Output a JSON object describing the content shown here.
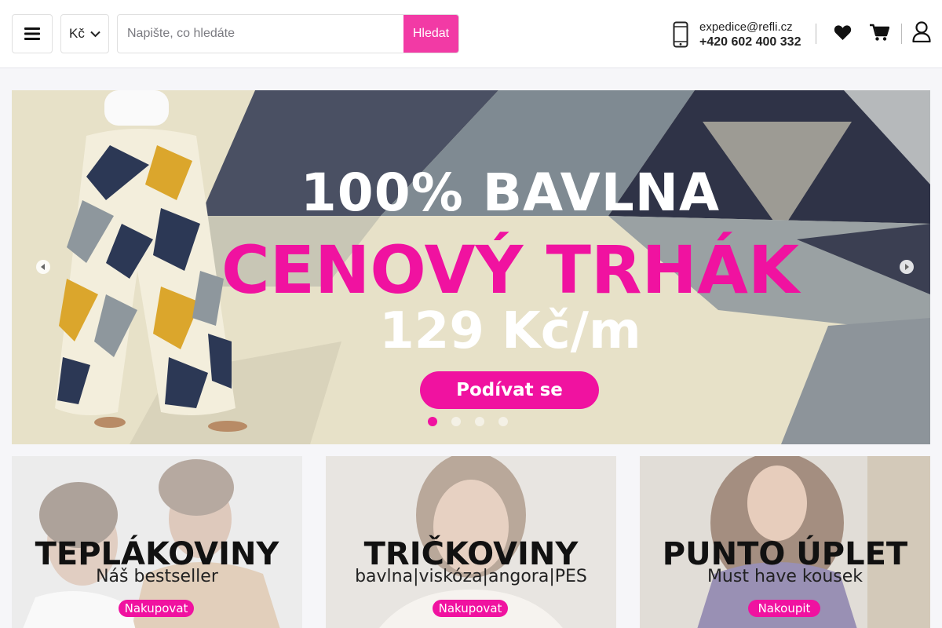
{
  "header": {
    "currency": "Kč",
    "search_placeholder": "Napište, co hledáte",
    "search_button": "Hledat",
    "email": "expedice@refli.cz",
    "phone": "+420 602 400 332"
  },
  "hero": {
    "line1": "100% BAVLNA",
    "line2": "CENOVÝ TRHÁK",
    "line3": "129 Kč/m",
    "cta": "Podívat se",
    "slides": 4,
    "active_slide": 1
  },
  "categories": [
    {
      "title": "TEPLÁKOVINY",
      "subtitle": "Náš bestseller",
      "button": "Nakupovat"
    },
    {
      "title": "TRIČKOVINY",
      "subtitle": "bavlna|viskóza|angora|PES",
      "button": "Nakupovat"
    },
    {
      "title": "PUNTO ÚPLET",
      "subtitle": "Must have kousek",
      "button": "Nakoupit"
    }
  ],
  "colors": {
    "accent": "#f23aa5",
    "hero_pink": "#f012a0"
  }
}
